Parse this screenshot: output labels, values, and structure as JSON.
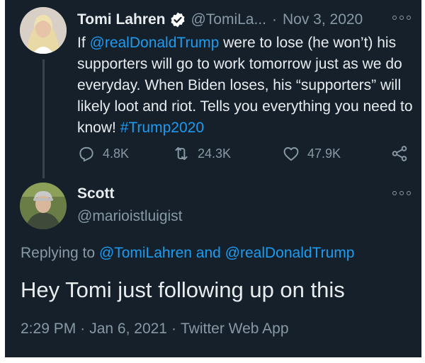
{
  "original_tweet": {
    "display_name": "Tomi Lahren",
    "handle": "@TomiLa...",
    "separator": "·",
    "date": "Nov 3, 2020",
    "text_parts": [
      {
        "type": "text",
        "value": "If "
      },
      {
        "type": "link",
        "value": "@realDonaldTrump"
      },
      {
        "type": "text",
        "value": " were to lose (he won’t) his supporters will go to work tomorrow just as we do everyday. When Biden loses, his “supporters” will likely loot and riot. Tells you everything you need to know! "
      },
      {
        "type": "link",
        "value": "#Trump2020"
      }
    ],
    "replies_count": "4.8K",
    "retweets_count": "24.3K",
    "likes_count": "47.9K"
  },
  "reply_tweet": {
    "display_name": "Scott",
    "handle": "@marioistluigist",
    "replying_prefix": "Replying to ",
    "replying_user1": "@TomiLahren",
    "replying_and": " and ",
    "replying_user2": "@realDonaldTrump",
    "text": "Hey Tomi just following up on this",
    "time": "2:29 PM",
    "separator": "·",
    "date": "Jan 6, 2021",
    "source": "Twitter Web App"
  },
  "icons": {
    "verified": "verified-badge-icon",
    "more": "more-horizontal-icon",
    "reply": "reply-icon",
    "retweet": "retweet-icon",
    "like": "heart-icon",
    "share": "share-icon"
  },
  "colors": {
    "background": "#15202b",
    "primary_text": "#e8ecef",
    "secondary_text": "#8899a6",
    "link": "#1d9bf0",
    "thread_line": "#38444d"
  }
}
